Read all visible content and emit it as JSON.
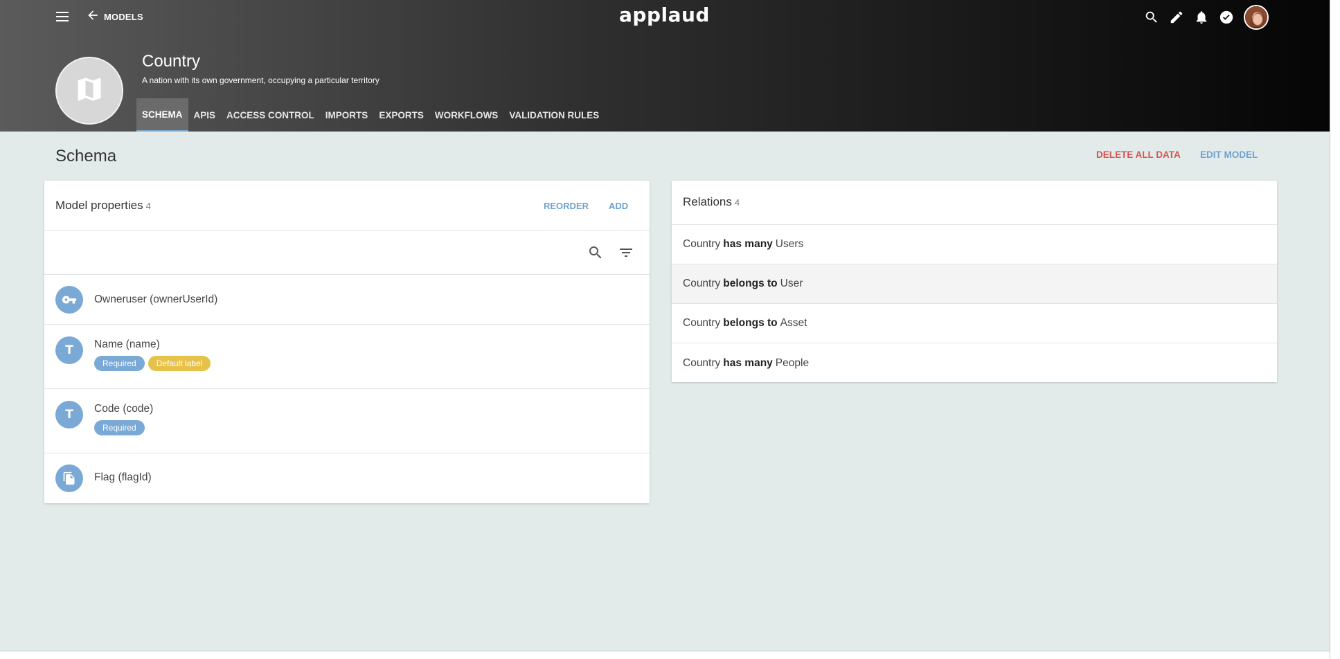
{
  "header": {
    "back_label": "MODELS",
    "logo": "applaud",
    "icons": [
      "menu-icon",
      "arrow-back-icon",
      "search-icon",
      "edit-icon",
      "bell-icon",
      "check-circle-icon"
    ]
  },
  "model": {
    "title": "Country",
    "description": "A nation with its own government, occupying a particular territory",
    "icon": "map-icon"
  },
  "tabs": [
    {
      "label": "SCHEMA",
      "active": true
    },
    {
      "label": "APIS",
      "active": false
    },
    {
      "label": "ACCESS CONTROL",
      "active": false
    },
    {
      "label": "IMPORTS",
      "active": false
    },
    {
      "label": "EXPORTS",
      "active": false
    },
    {
      "label": "WORKFLOWS",
      "active": false
    },
    {
      "label": "VALIDATION RULES",
      "active": false
    }
  ],
  "section": {
    "title": "Schema",
    "delete_label": "DELETE ALL DATA",
    "edit_label": "EDIT MODEL"
  },
  "properties": {
    "title": "Model properties",
    "count": "4",
    "reorder_label": "REORDER",
    "add_label": "ADD",
    "items": [
      {
        "name": "Owneruser (ownerUserId)",
        "icon": "key-icon",
        "tags": []
      },
      {
        "name": "Name (name)",
        "icon": "text-icon",
        "letter": "T",
        "tags": [
          "Required",
          "Default label"
        ]
      },
      {
        "name": "Code (code)",
        "icon": "text-icon",
        "letter": "T",
        "tags": [
          "Required"
        ]
      },
      {
        "name": "Flag (flagId)",
        "icon": "file-icon",
        "tags": []
      }
    ]
  },
  "relations": {
    "title": "Relations",
    "count": "4",
    "items": [
      {
        "subject": "Country",
        "verb": "has many",
        "target": "Users"
      },
      {
        "subject": "Country",
        "verb": "belongs to",
        "target": "User"
      },
      {
        "subject": "Country",
        "verb": "belongs to",
        "target": "Asset"
      },
      {
        "subject": "Country",
        "verb": "has many",
        "target": "People"
      }
    ]
  },
  "colors": {
    "accent": "#6fa2cf",
    "danger": "#d9534f",
    "required_tag": "#7aa9d6",
    "default_tag": "#e7c24a",
    "background": "#e3ebea"
  }
}
